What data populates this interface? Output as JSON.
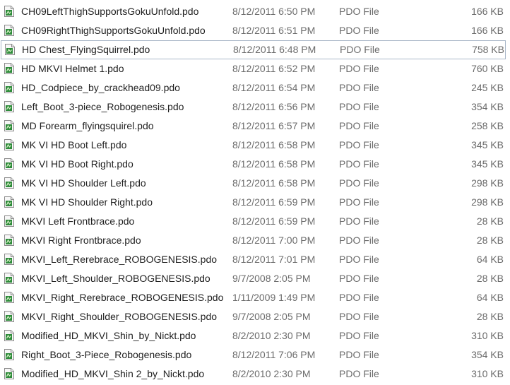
{
  "file_icon": "pdo-file-icon",
  "colors": {
    "selection_border": "#a9b7c8",
    "icon_green": "#2e8b3a"
  },
  "files": [
    {
      "name": "CH09LeftThighSupportsGokuUnfold.pdo",
      "date": "8/12/2011 6:50 PM",
      "type": "PDO File",
      "size": "166 KB"
    },
    {
      "name": "CH09RightThighSupportsGokuUnfold.pdo",
      "date": "8/12/2011 6:51 PM",
      "type": "PDO File",
      "size": "166 KB"
    },
    {
      "name": "HD Chest_FlyingSquirrel.pdo",
      "date": "8/12/2011 6:48 PM",
      "type": "PDO File",
      "size": "758 KB",
      "selected": true
    },
    {
      "name": "HD MKVI Helmet 1.pdo",
      "date": "8/12/2011 6:52 PM",
      "type": "PDO File",
      "size": "760 KB"
    },
    {
      "name": "HD_Codpiece_by_crackhead09.pdo",
      "date": "8/12/2011 6:54 PM",
      "type": "PDO File",
      "size": "245 KB"
    },
    {
      "name": "Left_Boot_3-piece_Robogenesis.pdo",
      "date": "8/12/2011 6:56 PM",
      "type": "PDO File",
      "size": "354 KB"
    },
    {
      "name": "MD Forearm_flyingsquirel.pdo",
      "date": "8/12/2011 6:57 PM",
      "type": "PDO File",
      "size": "258 KB"
    },
    {
      "name": "MK VI HD Boot Left.pdo",
      "date": "8/12/2011 6:58 PM",
      "type": "PDO File",
      "size": "345 KB"
    },
    {
      "name": "MK VI HD Boot Right.pdo",
      "date": "8/12/2011 6:58 PM",
      "type": "PDO File",
      "size": "345 KB"
    },
    {
      "name": "MK VI HD Shoulder Left.pdo",
      "date": "8/12/2011 6:58 PM",
      "type": "PDO File",
      "size": "298 KB"
    },
    {
      "name": "MK VI HD Shoulder Right.pdo",
      "date": "8/12/2011 6:59 PM",
      "type": "PDO File",
      "size": "298 KB"
    },
    {
      "name": "MKVI Left Frontbrace.pdo",
      "date": "8/12/2011 6:59 PM",
      "type": "PDO File",
      "size": "28 KB"
    },
    {
      "name": "MKVI Right Frontbrace.pdo",
      "date": "8/12/2011 7:00 PM",
      "type": "PDO File",
      "size": "28 KB"
    },
    {
      "name": "MKVI_Left_Rerebrace_ROBOGENESIS.pdo",
      "date": "8/12/2011 7:01 PM",
      "type": "PDO File",
      "size": "64 KB"
    },
    {
      "name": "MKVI_Left_Shoulder_ROBOGENESIS.pdo",
      "date": "9/7/2008 2:05 PM",
      "type": "PDO File",
      "size": "28 KB"
    },
    {
      "name": "MKVI_Right_Rerebrace_ROBOGENESIS.pdo",
      "date": "1/11/2009 1:49 PM",
      "type": "PDO File",
      "size": "64 KB"
    },
    {
      "name": "MKVI_Right_Shoulder_ROBOGENESIS.pdo",
      "date": "9/7/2008 2:05 PM",
      "type": "PDO File",
      "size": "28 KB"
    },
    {
      "name": "Modified_HD_MKVI_Shin_by_Nickt.pdo",
      "date": "8/2/2010 2:30 PM",
      "type": "PDO File",
      "size": "310 KB"
    },
    {
      "name": "Right_Boot_3-Piece_Robogenesis.pdo",
      "date": "8/12/2011 7:06 PM",
      "type": "PDO File",
      "size": "354 KB"
    },
    {
      "name": "Modified_HD_MKVI_Shin 2_by_Nickt.pdo",
      "date": "8/2/2010 2:30 PM",
      "type": "PDO File",
      "size": "310 KB"
    }
  ]
}
